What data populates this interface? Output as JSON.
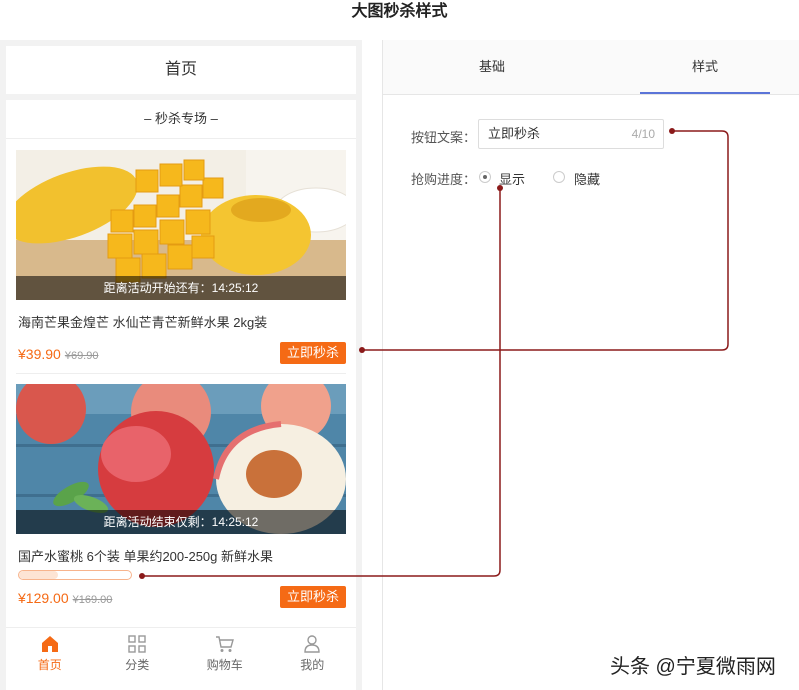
{
  "page_title": "大图秒杀样式",
  "phone": {
    "header_title": "首页",
    "section_title": "– 秒杀专场 –",
    "products": [
      {
        "countdown": "距离活动开始还有：14:25:12",
        "name": "海南芒果金煌芒 水仙芒青芒新鲜水果 2kg装",
        "price": "¥39.90",
        "old_price": "¥69.90",
        "button": "立即秒杀"
      },
      {
        "countdown": "距离活动结束仅剩：14:25:12",
        "name": "国产水蜜桃 6个装 单果约200-250g 新鲜水果",
        "price": "¥129.00",
        "old_price": "¥169.00",
        "button": "立即秒杀",
        "progress": 0.35
      }
    ],
    "tabbar": [
      {
        "label": "首页",
        "icon": "home-icon"
      },
      {
        "label": "分类",
        "icon": "category-icon"
      },
      {
        "label": "购物车",
        "icon": "cart-icon"
      },
      {
        "label": "我的",
        "icon": "user-icon"
      }
    ]
  },
  "panel": {
    "tabs": [
      "基础",
      "样式"
    ],
    "button_text_label": "按钮文案：",
    "button_text_value": "立即秒杀",
    "button_text_count": "4/10",
    "progress_label": "抢购进度：",
    "progress_options": [
      "显示",
      "隐藏"
    ],
    "progress_selected": "显示"
  },
  "colors": {
    "accent": "#f56a15",
    "tab_active": "#5b74d8",
    "connector": "#8b1a1a"
  },
  "watermark": "头条 @宁夏微雨网"
}
